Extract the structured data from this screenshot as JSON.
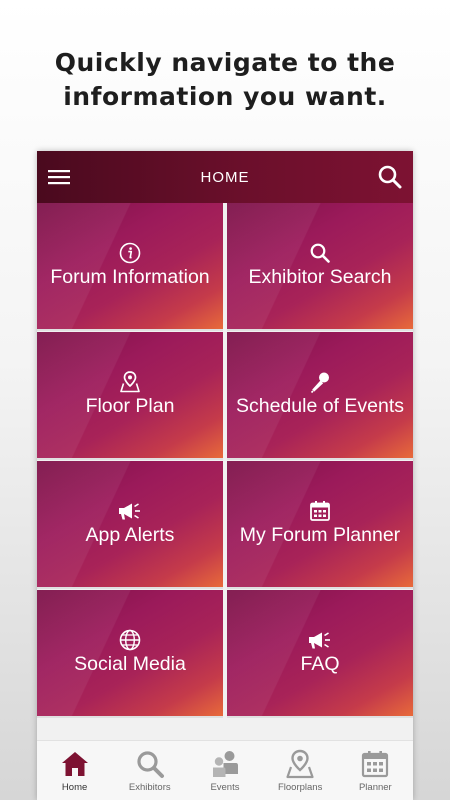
{
  "headline": {
    "line1": "Quickly navigate to the",
    "line2": "information you want."
  },
  "appbar": {
    "title": "HOME",
    "menu_icon": "hamburger-menu-icon",
    "search_icon": "search-icon"
  },
  "tiles": [
    {
      "label": "Forum Information",
      "icon": "info-icon"
    },
    {
      "label": "Exhibitor Search",
      "icon": "search-icon"
    },
    {
      "label": "Floor Plan",
      "icon": "map-pin-icon"
    },
    {
      "label": "Schedule of Events",
      "icon": "microphone-icon"
    },
    {
      "label": "App Alerts",
      "icon": "megaphone-icon"
    },
    {
      "label": "My Forum Planner",
      "icon": "calendar-icon"
    },
    {
      "label": "Social Media",
      "icon": "globe-icon"
    },
    {
      "label": "FAQ",
      "icon": "megaphone-icon"
    }
  ],
  "tabbar": {
    "items": [
      {
        "label": "Home",
        "icon": "home-icon",
        "active": true
      },
      {
        "label": "Exhibitors",
        "icon": "search-icon",
        "active": false
      },
      {
        "label": "Events",
        "icon": "people-icon",
        "active": false
      },
      {
        "label": "Floorplans",
        "icon": "map-pin-icon",
        "active": false
      },
      {
        "label": "Planner",
        "icon": "calendar-icon",
        "active": false
      }
    ]
  },
  "colors": {
    "appbar": "#6b0f2b",
    "tile_primary": "#9b1a5a",
    "tile_accent": "#e86a3a",
    "tab_active": "#7d1232",
    "tab_inactive": "#9a9a9a"
  }
}
